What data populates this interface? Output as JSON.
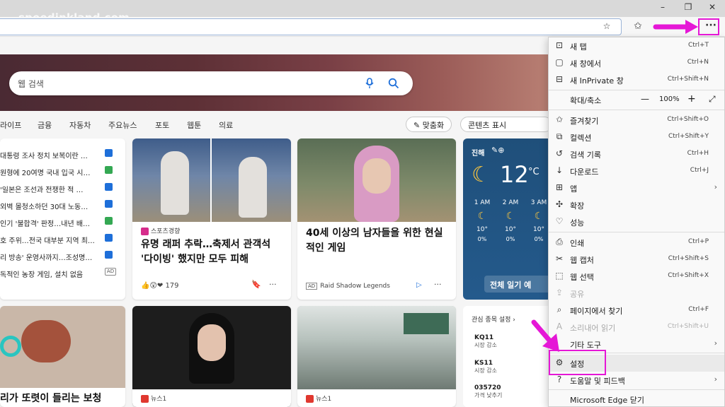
{
  "watermark": "speedinkland.com",
  "window_controls": {
    "minimize": "–",
    "restore": "❐",
    "close": "✕"
  },
  "toolbar": {
    "more_label": "···"
  },
  "search": {
    "placeholder": "웹 검색"
  },
  "nav": {
    "items": [
      "라이프",
      "금융",
      "자동차",
      "주요뉴스",
      "포토",
      "웹툰",
      "의료"
    ],
    "personalize": "맞춤화",
    "content_display": "콘텐츠 표시"
  },
  "news_list": [
    {
      "text": "대통령 조사 정치 보복이란 …",
      "badge": "blue"
    },
    {
      "text": "원형에 20여명 국내 입국 시…",
      "badge": "green"
    },
    {
      "text": "'일본은 조선과 전쟁한 적 …",
      "badge": "blue"
    },
    {
      "text": "외벽 몰청소하던 30대 노동…",
      "badge": "blue"
    },
    {
      "text": "인기 '불합격' 판정…내년 배…",
      "badge": "green"
    },
    {
      "text": "호 주위…전국 대부분 지역 최…",
      "badge": "blue"
    },
    {
      "text": "리 방송' 운영사까지…조성명…",
      "badge": "blue"
    },
    {
      "text": "독적인 농장 게임, 설치 없음",
      "badge": "ad",
      "badge_text": "AD"
    }
  ],
  "card_rapper": {
    "source": "스포츠경향",
    "headline": "유명 래퍼 추락…축제서 관객석 '다이빙' 했지만 모두 피해",
    "reactions": "179"
  },
  "card_game": {
    "headline": "40세 이상의 남자들을 위한 현실적인 게임",
    "ad_label": "AD",
    "advertiser": "Raid Shadow Legends"
  },
  "weather": {
    "location": "진해",
    "temp": "12",
    "unit": "°C",
    "hours": [
      {
        "time": "1 AM",
        "temp": "10°",
        "rain": "0%"
      },
      {
        "time": "2 AM",
        "temp": "10°",
        "rain": "0%"
      },
      {
        "time": "3 AM",
        "temp": "10°",
        "rain": "0%"
      }
    ],
    "button": "전체 일기 예"
  },
  "bottom_left": {
    "headline": "리가 또렷이 들리는 보청"
  },
  "bottom_mid": {
    "source": "뉴스1"
  },
  "bottom_right": {
    "source": "뉴스1"
  },
  "stocks": {
    "title": "관심 종목 설정",
    "items": [
      {
        "code": "KQ11",
        "status": "시장 감소"
      },
      {
        "code": "KS11",
        "status": "시장 감소"
      },
      {
        "code": "035720",
        "status": "가격 낮추기"
      }
    ]
  },
  "menu": {
    "items": [
      {
        "icon": "new-tab",
        "label": "새 탭",
        "shortcut": "Ctrl+T"
      },
      {
        "icon": "new-window",
        "label": "새 창에서",
        "shortcut": "Ctrl+N"
      },
      {
        "icon": "inprivate",
        "label": "새 InPrivate 창",
        "shortcut": "Ctrl+Shift+N"
      },
      {
        "icon": "star",
        "label": "즐겨찾기",
        "shortcut": "Ctrl+Shift+O"
      },
      {
        "icon": "collections",
        "label": "컬렉션",
        "shortcut": "Ctrl+Shift+Y"
      },
      {
        "icon": "history",
        "label": "검색 기록",
        "shortcut": "Ctrl+H"
      },
      {
        "icon": "download",
        "label": "다운로드",
        "shortcut": "Ctrl+J"
      },
      {
        "icon": "apps",
        "label": "앱",
        "shortcut": ""
      },
      {
        "icon": "extensions",
        "label": "확장",
        "shortcut": ""
      },
      {
        "icon": "performance",
        "label": "성능",
        "shortcut": ""
      },
      {
        "icon": "print",
        "label": "인쇄",
        "shortcut": "Ctrl+P"
      },
      {
        "icon": "web-capture",
        "label": "웹 캡처",
        "shortcut": "Ctrl+Shift+S"
      },
      {
        "icon": "web-select",
        "label": "웹 선택",
        "shortcut": "Ctrl+Shift+X"
      },
      {
        "icon": "share",
        "label": "공유",
        "shortcut": ""
      },
      {
        "icon": "find",
        "label": "페이지에서 찾기",
        "shortcut": "Ctrl+F"
      },
      {
        "icon": "read-aloud",
        "label": "소리내어 읽기",
        "shortcut": "Ctrl+Shift+U"
      },
      {
        "icon": "more-tools",
        "label": "기타 도구",
        "shortcut": ""
      },
      {
        "icon": "settings",
        "label": "설정",
        "shortcut": ""
      },
      {
        "icon": "help",
        "label": "도움말 및 피드백",
        "shortcut": ""
      },
      {
        "icon": "close",
        "label": "Microsoft Edge 닫기",
        "shortcut": ""
      }
    ],
    "zoom": {
      "label": "확대/축소",
      "minus": "—",
      "value": "100%",
      "plus": "+"
    }
  },
  "colors": {
    "highlight": "#e517d6",
    "accent": "#1e6fd9"
  }
}
